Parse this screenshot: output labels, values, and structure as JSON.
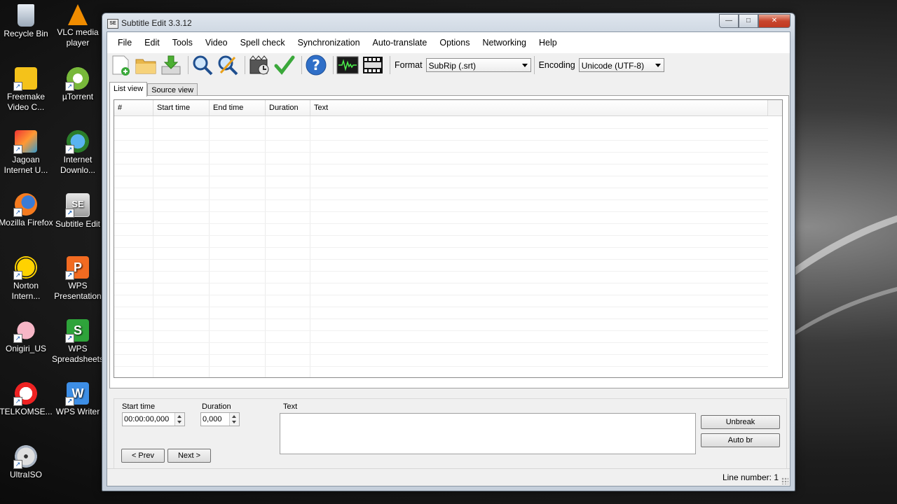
{
  "desktop": {
    "icons": [
      {
        "label": "Recycle Bin"
      },
      {
        "label": "VLC media player"
      },
      {
        "label": "Freemake Video C..."
      },
      {
        "label": "µTorrent"
      },
      {
        "label": "Jagoan Internet U..."
      },
      {
        "label": "Internet Downlo..."
      },
      {
        "label": "Mozilla Firefox"
      },
      {
        "label": "Subtitle Edit"
      },
      {
        "label": "Norton Intern..."
      },
      {
        "label": "WPS Presentation"
      },
      {
        "label": "Onigiri_US"
      },
      {
        "label": "WPS Spreadsheets"
      },
      {
        "label": "TELKOMSE..."
      },
      {
        "label": "WPS Writer"
      },
      {
        "label": "UltraISO"
      }
    ]
  },
  "window": {
    "title": "Subtitle Edit 3.3.12",
    "app_icon_text": "SE",
    "controls": {
      "minimize": "—",
      "maximize": "□",
      "close": "✕"
    }
  },
  "menu": [
    "File",
    "Edit",
    "Tools",
    "Video",
    "Spell check",
    "Synchronization",
    "Auto-translate",
    "Options",
    "Networking",
    "Help"
  ],
  "toolbar": {
    "buttons": [
      "new-icon",
      "open-folder-icon",
      "save-download-icon",
      "find-icon",
      "replace-icon",
      "video-open-icon",
      "spell-check-icon",
      "help-icon",
      "waveform-icon",
      "video-clapper-icon"
    ],
    "format_label": "Format",
    "format_value": "SubRip (.srt)",
    "encoding_label": "Encoding",
    "encoding_value": "Unicode (UTF-8)"
  },
  "tabs": [
    {
      "label": "List view",
      "active": true
    },
    {
      "label": "Source view",
      "active": false
    }
  ],
  "grid": {
    "columns": [
      "#",
      "Start time",
      "End time",
      "Duration",
      "Text"
    ]
  },
  "editor": {
    "start_time_label": "Start time",
    "start_time_value": "00:00:00,000",
    "duration_label": "Duration",
    "duration_value": "0,000",
    "text_label": "Text",
    "prev_label": "< Prev",
    "next_label": "Next >",
    "unbreak_label": "Unbreak",
    "auto_br_label": "Auto br"
  },
  "status": {
    "line_number": "Line number: 1"
  }
}
